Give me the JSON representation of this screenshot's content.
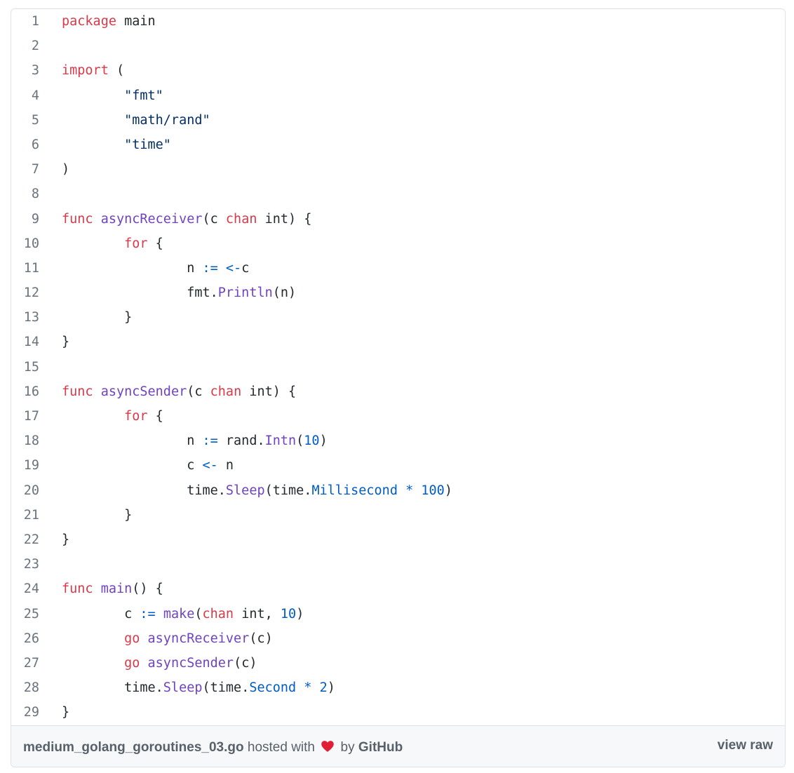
{
  "code": {
    "lines": [
      {
        "num": "1",
        "tokens": [
          {
            "t": "package",
            "c": "kw"
          },
          {
            "t": " main",
            "c": "plain"
          }
        ]
      },
      {
        "num": "2",
        "tokens": []
      },
      {
        "num": "3",
        "tokens": [
          {
            "t": "import",
            "c": "kw"
          },
          {
            "t": " (",
            "c": "plain"
          }
        ]
      },
      {
        "num": "4",
        "tokens": [
          {
            "t": "        ",
            "c": "plain"
          },
          {
            "t": "\"fmt\"",
            "c": "str"
          }
        ]
      },
      {
        "num": "5",
        "tokens": [
          {
            "t": "        ",
            "c": "plain"
          },
          {
            "t": "\"math/rand\"",
            "c": "str"
          }
        ]
      },
      {
        "num": "6",
        "tokens": [
          {
            "t": "        ",
            "c": "plain"
          },
          {
            "t": "\"time\"",
            "c": "str"
          }
        ]
      },
      {
        "num": "7",
        "tokens": [
          {
            "t": ")",
            "c": "plain"
          }
        ]
      },
      {
        "num": "8",
        "tokens": []
      },
      {
        "num": "9",
        "tokens": [
          {
            "t": "func",
            "c": "kw"
          },
          {
            "t": " ",
            "c": "plain"
          },
          {
            "t": "asyncReceiver",
            "c": "fn"
          },
          {
            "t": "(c ",
            "c": "plain"
          },
          {
            "t": "chan",
            "c": "kw"
          },
          {
            "t": " int) {",
            "c": "plain"
          }
        ]
      },
      {
        "num": "10",
        "tokens": [
          {
            "t": "        ",
            "c": "plain"
          },
          {
            "t": "for",
            "c": "kw"
          },
          {
            "t": " {",
            "c": "plain"
          }
        ]
      },
      {
        "num": "11",
        "tokens": [
          {
            "t": "                n ",
            "c": "plain"
          },
          {
            "t": ":=",
            "c": "op"
          },
          {
            "t": " ",
            "c": "plain"
          },
          {
            "t": "<-",
            "c": "op"
          },
          {
            "t": "c",
            "c": "plain"
          }
        ]
      },
      {
        "num": "12",
        "tokens": [
          {
            "t": "                fmt.",
            "c": "plain"
          },
          {
            "t": "Println",
            "c": "fn"
          },
          {
            "t": "(n)",
            "c": "plain"
          }
        ]
      },
      {
        "num": "13",
        "tokens": [
          {
            "t": "        }",
            "c": "plain"
          }
        ]
      },
      {
        "num": "14",
        "tokens": [
          {
            "t": "}",
            "c": "plain"
          }
        ]
      },
      {
        "num": "15",
        "tokens": []
      },
      {
        "num": "16",
        "tokens": [
          {
            "t": "func",
            "c": "kw"
          },
          {
            "t": " ",
            "c": "plain"
          },
          {
            "t": "asyncSender",
            "c": "fn"
          },
          {
            "t": "(c ",
            "c": "plain"
          },
          {
            "t": "chan",
            "c": "kw"
          },
          {
            "t": " int) {",
            "c": "plain"
          }
        ]
      },
      {
        "num": "17",
        "tokens": [
          {
            "t": "        ",
            "c": "plain"
          },
          {
            "t": "for",
            "c": "kw"
          },
          {
            "t": " {",
            "c": "plain"
          }
        ]
      },
      {
        "num": "18",
        "tokens": [
          {
            "t": "                n ",
            "c": "plain"
          },
          {
            "t": ":=",
            "c": "op"
          },
          {
            "t": " rand.",
            "c": "plain"
          },
          {
            "t": "Intn",
            "c": "fn"
          },
          {
            "t": "(",
            "c": "plain"
          },
          {
            "t": "10",
            "c": "num"
          },
          {
            "t": ")",
            "c": "plain"
          }
        ]
      },
      {
        "num": "19",
        "tokens": [
          {
            "t": "                c ",
            "c": "plain"
          },
          {
            "t": "<-",
            "c": "op"
          },
          {
            "t": " n",
            "c": "plain"
          }
        ]
      },
      {
        "num": "20",
        "tokens": [
          {
            "t": "                time.",
            "c": "plain"
          },
          {
            "t": "Sleep",
            "c": "fn"
          },
          {
            "t": "(time.",
            "c": "plain"
          },
          {
            "t": "Millisecond",
            "c": "op"
          },
          {
            "t": " ",
            "c": "plain"
          },
          {
            "t": "*",
            "c": "op"
          },
          {
            "t": " ",
            "c": "plain"
          },
          {
            "t": "100",
            "c": "num"
          },
          {
            "t": ")",
            "c": "plain"
          }
        ]
      },
      {
        "num": "21",
        "tokens": [
          {
            "t": "        }",
            "c": "plain"
          }
        ]
      },
      {
        "num": "22",
        "tokens": [
          {
            "t": "}",
            "c": "plain"
          }
        ]
      },
      {
        "num": "23",
        "tokens": []
      },
      {
        "num": "24",
        "tokens": [
          {
            "t": "func",
            "c": "kw"
          },
          {
            "t": " ",
            "c": "plain"
          },
          {
            "t": "main",
            "c": "fn"
          },
          {
            "t": "() {",
            "c": "plain"
          }
        ]
      },
      {
        "num": "25",
        "tokens": [
          {
            "t": "        c ",
            "c": "plain"
          },
          {
            "t": ":=",
            "c": "op"
          },
          {
            "t": " ",
            "c": "plain"
          },
          {
            "t": "make",
            "c": "fn"
          },
          {
            "t": "(",
            "c": "plain"
          },
          {
            "t": "chan",
            "c": "kw"
          },
          {
            "t": " int, ",
            "c": "plain"
          },
          {
            "t": "10",
            "c": "num"
          },
          {
            "t": ")",
            "c": "plain"
          }
        ]
      },
      {
        "num": "26",
        "tokens": [
          {
            "t": "        ",
            "c": "plain"
          },
          {
            "t": "go",
            "c": "kw"
          },
          {
            "t": " ",
            "c": "plain"
          },
          {
            "t": "asyncReceiver",
            "c": "fn"
          },
          {
            "t": "(c)",
            "c": "plain"
          }
        ]
      },
      {
        "num": "27",
        "tokens": [
          {
            "t": "        ",
            "c": "plain"
          },
          {
            "t": "go",
            "c": "kw"
          },
          {
            "t": " ",
            "c": "plain"
          },
          {
            "t": "asyncSender",
            "c": "fn"
          },
          {
            "t": "(c)",
            "c": "plain"
          }
        ]
      },
      {
        "num": "28",
        "tokens": [
          {
            "t": "        time.",
            "c": "plain"
          },
          {
            "t": "Sleep",
            "c": "fn"
          },
          {
            "t": "(time.",
            "c": "plain"
          },
          {
            "t": "Second",
            "c": "op"
          },
          {
            "t": " ",
            "c": "plain"
          },
          {
            "t": "*",
            "c": "op"
          },
          {
            "t": " ",
            "c": "plain"
          },
          {
            "t": "2",
            "c": "num"
          },
          {
            "t": ")",
            "c": "plain"
          }
        ]
      },
      {
        "num": "29",
        "tokens": [
          {
            "t": "}",
            "c": "plain"
          }
        ]
      }
    ]
  },
  "footer": {
    "filename": "medium_golang_goroutines_03.go",
    "hosted_text": " hosted with ",
    "heart_icon": "heart-icon",
    "by_text": " by ",
    "brand": "GitHub",
    "view_raw": "view raw"
  },
  "colors": {
    "keyword": "#d73a49",
    "function": "#6f42c1",
    "string": "#032f62",
    "operator": "#005cc5",
    "line_number": "#6a737d",
    "footer_bg": "#f6f8fa",
    "heart": "#e01e36"
  }
}
